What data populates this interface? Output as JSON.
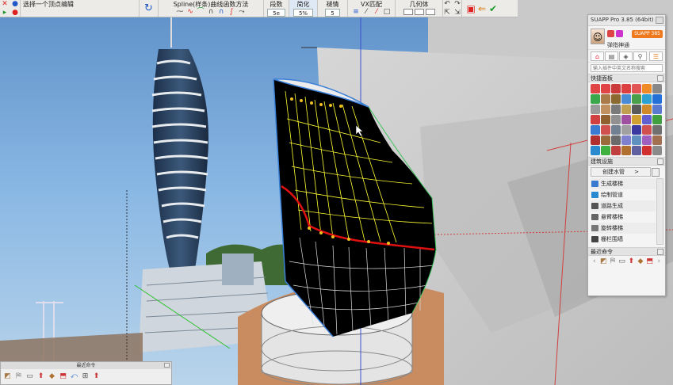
{
  "toolbar": {
    "status_text": "选择一个顶点编辑",
    "spline_method_label": "Spline(样条)曲线函数方法",
    "segments_label": "段数",
    "segments_value": "5e",
    "simplify_label": "简化",
    "simplify_value": "5%",
    "fade_label": "褪情",
    "fade_value": "5",
    "vx_match_label": "VX匹配",
    "geometry_label": "几何体"
  },
  "panel": {
    "title": "SUAPP Pro 3.85 (64bit)",
    "username": "弹指神通",
    "pro_badge": "SUAPP 385",
    "search_placeholder": "输入插件中英文名称搜索",
    "quick_section": "快捷面板",
    "arch_section": "建筑设施",
    "category_select": "创建水管",
    "items": [
      "生成楼梯",
      "绘制管道",
      "道路生成",
      "悬臂楼梯",
      "旋转楼梯",
      "栅栏围墙"
    ],
    "recent_section": "最近命令"
  },
  "mini_toolbar": {
    "title": "最近命令"
  },
  "colors": {
    "accent": "#ee7a1d",
    "toolbar_bg": "#ecebe8",
    "sky": "#7fb2e0",
    "model": "#000000",
    "grid_line": "#ffff33",
    "red_curve": "#e01010"
  },
  "quick_icons": [
    "#e04444",
    "#e04444",
    "#cc3b3b",
    "#dd4040",
    "#e25555",
    "#f08a25",
    "#888888",
    "#3aa84a",
    "#a87b48",
    "#8a6a30",
    "#4a8bd6",
    "#4aa04a",
    "#2ca0d0",
    "#2370d9",
    "#9a9a9a",
    "#c09060",
    "#7a7a7a",
    "#c0a050",
    "#5a5a5a",
    "#d08a2a",
    "#5a7ad0",
    "#d04040",
    "#906030",
    "#909090",
    "#a050a0",
    "#d0a030",
    "#6060d0",
    "#40a040",
    "#3a7ad0",
    "#d05050",
    "#708090",
    "#a0a0a0",
    "#3a3aa0",
    "#d05050",
    "#707070",
    "#b03030",
    "#9a6a3a",
    "#6a6a6a",
    "#8080d0",
    "#6090c0",
    "#a060c0",
    "#a07050",
    "#2a8ad0",
    "#40b040",
    "#c04040",
    "#b07030",
    "#6060a0",
    "#d03030",
    "#8a8a8a"
  ],
  "list_icon_colors": [
    "#3a7ad0",
    "#2a8ad0",
    "#555555",
    "#666666",
    "#777777",
    "#444444"
  ]
}
